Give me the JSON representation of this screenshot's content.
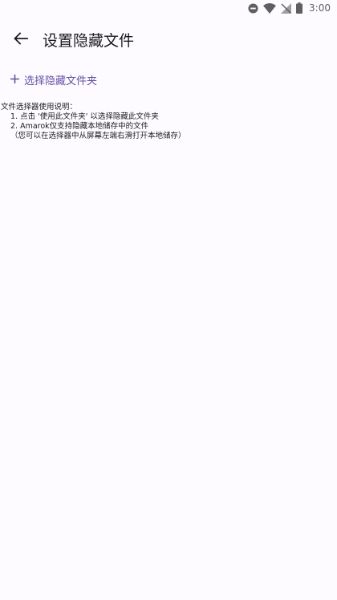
{
  "status_bar": {
    "time": "3:00",
    "icons": [
      "do-not-disturb-icon",
      "wifi-icon",
      "no-signal-icon",
      "battery-icon"
    ]
  },
  "app_bar": {
    "back_icon": "arrow-back-icon",
    "title": "设置隐藏文件"
  },
  "actions": {
    "select_folder_icon": "plus-icon",
    "select_folder_label": "选择隐藏文件夹"
  },
  "instructions": {
    "heading": "文件选择器使用说明：",
    "line1": "1. 点击 '使用此文件夹' 以选择隐藏此文件夹",
    "line2": "2. Amarok仅支持隐藏本地储存中的文件",
    "line3": "（您可以在选择器中从屏幕左端右滑打开本地储存）"
  },
  "colors": {
    "background": "#fdfbff",
    "accent": "#6750a4",
    "text": "#1c1b1f",
    "status_icons": "#5f5f5f"
  }
}
